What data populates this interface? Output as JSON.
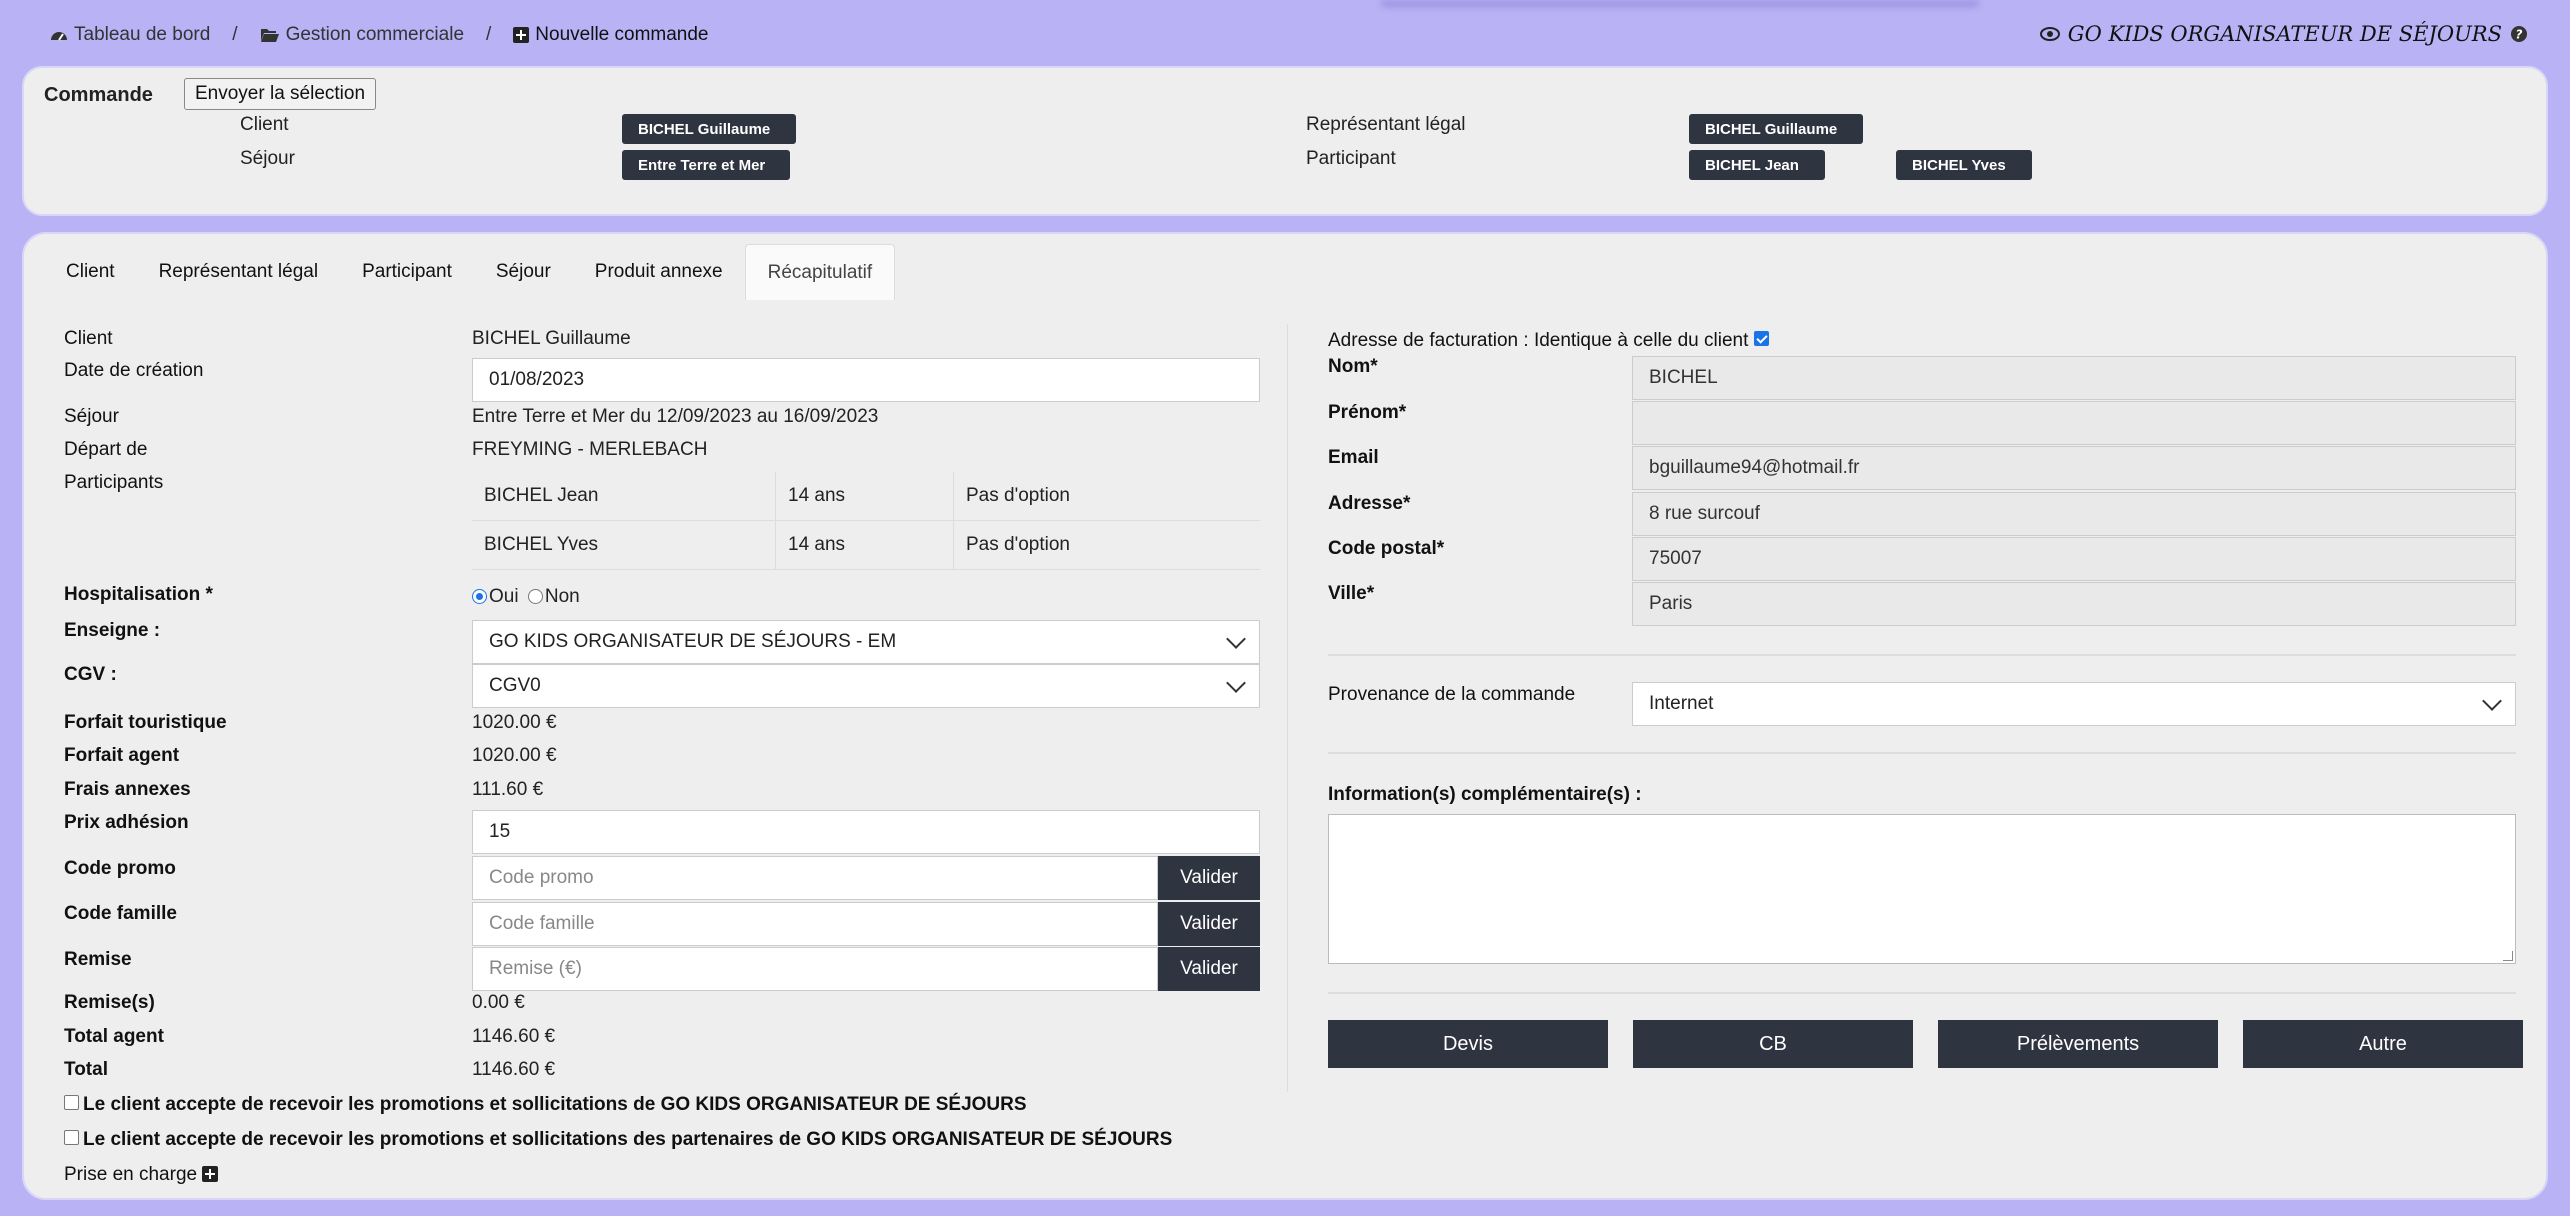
{
  "breadcrumb": {
    "items": [
      {
        "label": "Tableau de bord",
        "icon": "dashboard-icon"
      },
      {
        "label": "Gestion commerciale",
        "icon": "folder-open-icon"
      },
      {
        "label": "Nouvelle commande",
        "icon": "plus-square-icon"
      }
    ],
    "separator": "/"
  },
  "brand": {
    "label": "GO KIDS ORGANISATEUR DE SÉJOURS",
    "icon": "eye-icon",
    "help_icon": "question-circle-icon"
  },
  "commande": {
    "title": "Commande",
    "send_button": "Envoyer la sélection",
    "client_label": "Client",
    "client_chip": "BICHEL Guillaume",
    "sejour_label": "Séjour",
    "sejour_chip": "Entre Terre et Mer",
    "representant_label": "Représentant légal",
    "representant_chip": "BICHEL Guillaume",
    "participant_label": "Participant",
    "participant_chips": [
      "BICHEL Jean",
      "BICHEL Yves"
    ]
  },
  "tabs": [
    {
      "label": "Client",
      "active": false
    },
    {
      "label": "Représentant légal",
      "active": false
    },
    {
      "label": "Participant",
      "active": false
    },
    {
      "label": "Séjour",
      "active": false
    },
    {
      "label": "Produit annexe",
      "active": false
    },
    {
      "label": "Récapitulatif",
      "active": true
    }
  ],
  "recap": {
    "client": {
      "label": "Client",
      "value": "BICHEL Guillaume"
    },
    "date_creation": {
      "label": "Date de création",
      "value": "01/08/2023"
    },
    "sejour": {
      "label": "Séjour",
      "value": "Entre Terre et Mer du 12/09/2023 au 16/09/2023"
    },
    "depart": {
      "label": "Départ de",
      "value": "FREYMING - MERLEBACH"
    },
    "participants": {
      "label": "Participants",
      "rows": [
        {
          "name": "BICHEL Jean",
          "age": "14 ans",
          "option": "Pas d'option"
        },
        {
          "name": "BICHEL Yves",
          "age": "14 ans",
          "option": "Pas d'option"
        }
      ]
    },
    "hospitalisation": {
      "label": "Hospitalisation *",
      "oui": "Oui",
      "non": "Non",
      "selected": "Oui"
    },
    "enseigne": {
      "label": "Enseigne :",
      "value": "GO KIDS ORGANISATEUR DE SÉJOURS - EM"
    },
    "cgv": {
      "label": "CGV :",
      "value": "CGV0"
    },
    "forfait_touristique": {
      "label": "Forfait touristique",
      "value": "1020.00 €"
    },
    "forfait_agent": {
      "label": "Forfait agent",
      "value": "1020.00 €"
    },
    "frais_annexes": {
      "label": "Frais annexes",
      "value": "111.60 €"
    },
    "prix_adhesion": {
      "label": "Prix adhésion",
      "value": "15"
    },
    "code_promo": {
      "label": "Code promo",
      "placeholder": "Code promo",
      "button": "Valider"
    },
    "code_famille": {
      "label": "Code famille",
      "placeholder": "Code famille",
      "button": "Valider"
    },
    "remise": {
      "label": "Remise",
      "placeholder": "Remise (€)",
      "button": "Valider"
    },
    "remises": {
      "label": "Remise(s)",
      "value": "0.00 €"
    },
    "total_agent": {
      "label": "Total agent",
      "value": "1146.60 €"
    },
    "total": {
      "label": "Total",
      "value": "1146.60 €"
    },
    "consent1": "Le client accepte de recevoir les promotions et sollicitations de GO KIDS ORGANISATEUR DE SÉJOURS",
    "consent2": "Le client accepte de recevoir les promotions et sollicitations des partenaires de GO KIDS ORGANISATEUR DE SÉJOURS",
    "prise_en_charge": "Prise en charge"
  },
  "facturation": {
    "same_as_client_label": "Adresse de facturation : Identique à celle du client",
    "same_as_client_checked": true,
    "nom": {
      "label": "Nom*",
      "value": "BICHEL"
    },
    "prenom": {
      "label": "Prénom*",
      "value": ""
    },
    "email": {
      "label": "Email",
      "value": "bguillaume94@hotmail.fr"
    },
    "adresse": {
      "label": "Adresse*",
      "value": "8 rue surcouf"
    },
    "code_postal": {
      "label": "Code postal*",
      "value": "75007"
    },
    "ville": {
      "label": "Ville*",
      "value": "Paris"
    },
    "provenance": {
      "label": "Provenance de la commande",
      "value": "Internet"
    },
    "info_label": "Information(s) complémentaire(s) :",
    "info_value": ""
  },
  "actions": [
    "Devis",
    "CB",
    "Prélèvements",
    "Autre"
  ]
}
